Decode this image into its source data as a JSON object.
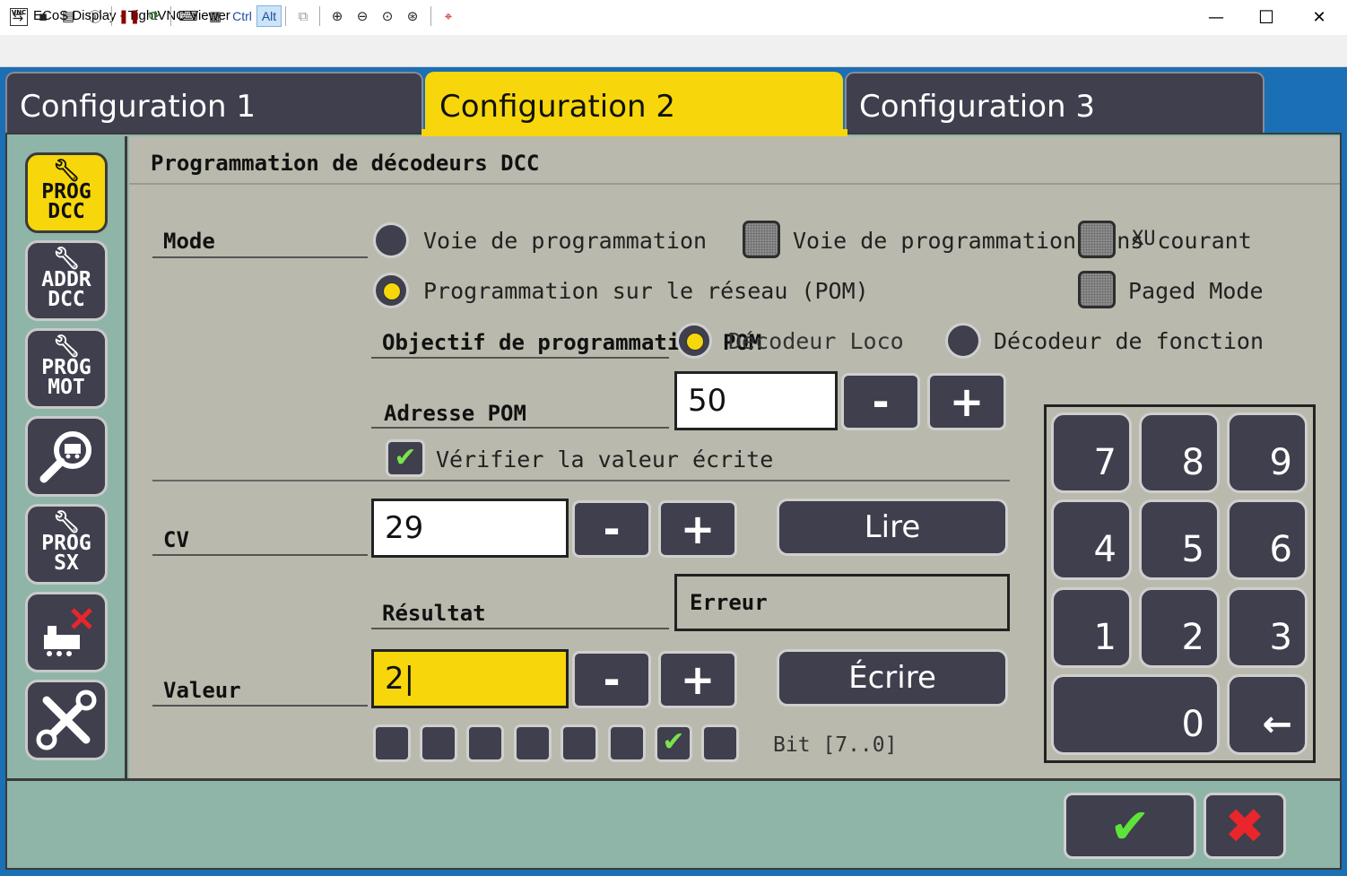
{
  "window": {
    "title": "ECoS Display - TightVNC Viewer",
    "icon_text": "VNC",
    "minimize": "—",
    "maximize": "☐",
    "close": "✕"
  },
  "toolbar": {
    "ctrl_label": "Ctrl",
    "alt_label": "Alt"
  },
  "tabs": [
    {
      "label": "Configuration 1",
      "active": false
    },
    {
      "label": "Configuration 2",
      "active": true
    },
    {
      "label": "Configuration 3",
      "active": false
    }
  ],
  "sidebar": [
    {
      "line1": "PROG",
      "line2": "DCC",
      "active": true,
      "icon": "wrench-icon"
    },
    {
      "line1": "ADDR",
      "line2": "DCC",
      "active": false,
      "icon": "wrench-icon"
    },
    {
      "line1": "PROG",
      "line2": "MOT",
      "active": false,
      "icon": "wrench-icon"
    },
    {
      "line1": "",
      "line2": "",
      "active": false,
      "icon": "magnifier-loco-icon"
    },
    {
      "line1": "PROG",
      "line2": "SX",
      "active": false,
      "icon": "wrench-icon"
    },
    {
      "line1": "",
      "line2": "",
      "active": false,
      "icon": "loco-delete-icon"
    },
    {
      "line1": "",
      "line2": "",
      "active": false,
      "icon": "tools-icon"
    }
  ],
  "page": {
    "title": "Programmation de décodeurs DCC"
  },
  "mode": {
    "label": "Mode",
    "options": [
      {
        "label": "Voie de programmation",
        "selected": false
      },
      {
        "label": "Voie de programmation sans courant",
        "selected": false
      },
      {
        "label": "Programmation sur le réseau (POM)",
        "selected": true
      },
      {
        "label": "Paged Mode",
        "selected": false
      }
    ],
    "overlay_check_label": "XU"
  },
  "objectif": {
    "label": "Objectif de programmation",
    "overlay": "POM",
    "options": [
      {
        "label": "Décodeur Loco",
        "selected": true
      },
      {
        "label": "Décodeur de fonction",
        "selected": false
      }
    ]
  },
  "pom": {
    "label": "Adresse POM",
    "value": "50",
    "minus": "-",
    "plus": "+"
  },
  "verify": {
    "label": "Vérifier la valeur écrite",
    "checked": true
  },
  "cv": {
    "label": "CV",
    "value": "29",
    "minus": "-",
    "plus": "+",
    "read_button": "Lire"
  },
  "result": {
    "label": "Résultat",
    "value": "Erreur"
  },
  "valeur": {
    "label": "Valeur",
    "value": "2|",
    "minus": "-",
    "plus": "+",
    "write_button": "Écrire"
  },
  "bits": {
    "label": "Bit [7..0]",
    "states": [
      false,
      false,
      false,
      false,
      false,
      false,
      true,
      false
    ]
  },
  "keypad": {
    "keys": [
      "7",
      "8",
      "9",
      "4",
      "5",
      "6",
      "1",
      "2",
      "3",
      "0",
      "←"
    ]
  },
  "actions": {
    "ok": "✔",
    "cancel": "✖",
    "ok_color": "#5fe33a",
    "cancel_color": "#e8262b"
  },
  "colors": {
    "accent": "#f7d60b",
    "button_dark": "#3f3f4e",
    "panel": "#8fb4a8",
    "content": "#b9b9ad"
  }
}
